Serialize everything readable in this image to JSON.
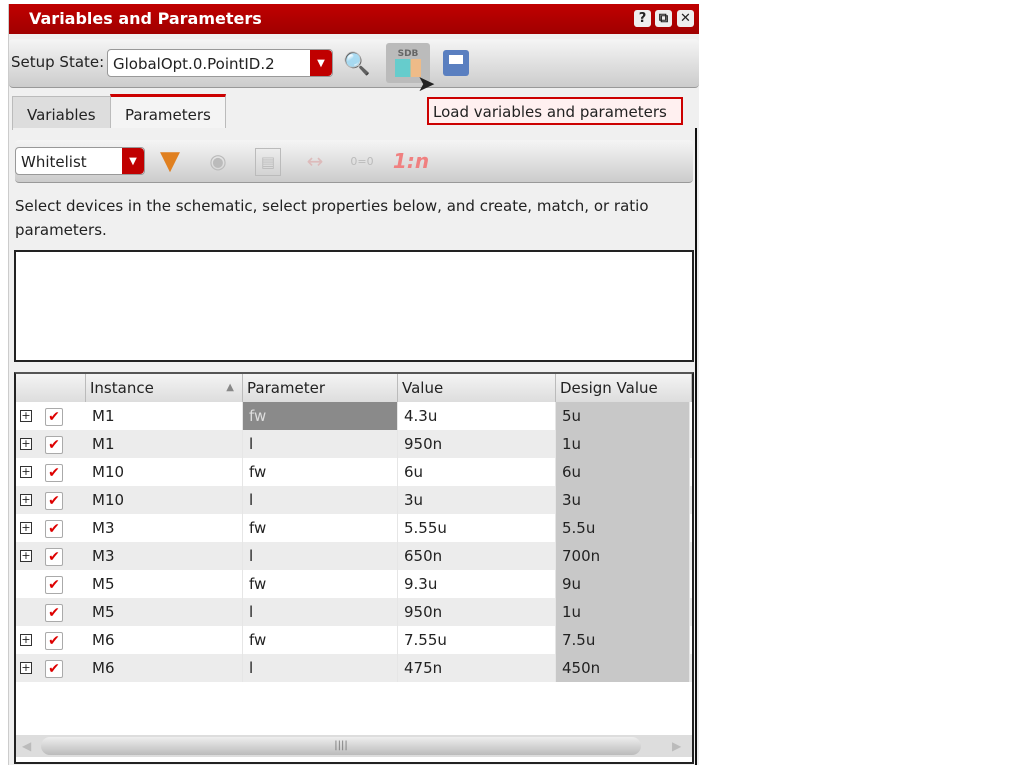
{
  "window": {
    "title": "Variables and Parameters",
    "help": "?",
    "restore": "⧉",
    "close": "✕"
  },
  "toolbar": {
    "setup_state_label": "Setup State:",
    "setup_state_value": "GlobalOpt.0.PointID.2",
    "sdb_label": "SDB"
  },
  "tooltip": "Load variables and parameters",
  "tabs": [
    {
      "label": "Variables"
    },
    {
      "label": "Parameters"
    }
  ],
  "filter": {
    "mode": "Whitelist",
    "ratio_label": "1:n",
    "match_label": "0=0"
  },
  "description": "Select devices in the schematic, select properties below, and create, match, or ratio parameters.",
  "table": {
    "columns": [
      "Instance",
      "Parameter",
      "Value",
      "Design Value"
    ],
    "rows": [
      {
        "instance": "M1",
        "parameter": "fw",
        "value": "4.3u",
        "design": "5u",
        "expandable": true
      },
      {
        "instance": "M1",
        "parameter": "l",
        "value": "950n",
        "design": "1u",
        "expandable": true
      },
      {
        "instance": "M10",
        "parameter": "fw",
        "value": "6u",
        "design": "6u",
        "expandable": true
      },
      {
        "instance": "M10",
        "parameter": "l",
        "value": "3u",
        "design": "3u",
        "expandable": true
      },
      {
        "instance": "M3",
        "parameter": "fw",
        "value": "5.55u",
        "design": "5.5u",
        "expandable": true
      },
      {
        "instance": "M3",
        "parameter": "l",
        "value": "650n",
        "design": "700n",
        "expandable": true
      },
      {
        "instance": "M5",
        "parameter": "fw",
        "value": "9.3u",
        "design": "9u",
        "expandable": false
      },
      {
        "instance": "M5",
        "parameter": "l",
        "value": "950n",
        "design": "1u",
        "expandable": false
      },
      {
        "instance": "M6",
        "parameter": "fw",
        "value": "7.55u",
        "design": "7.5u",
        "expandable": true
      },
      {
        "instance": "M6",
        "parameter": "l",
        "value": "475n",
        "design": "450n",
        "expandable": true
      }
    ]
  }
}
